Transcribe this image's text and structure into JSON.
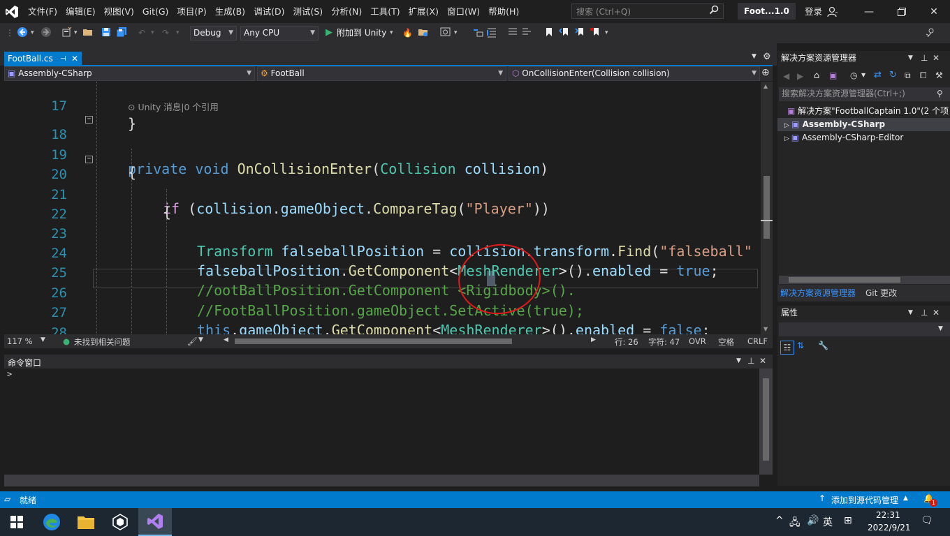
{
  "menu": {
    "items": [
      "文件(F)",
      "编辑(E)",
      "视图(V)",
      "Git(G)",
      "项目(P)",
      "生成(B)",
      "调试(D)",
      "测试(S)",
      "分析(N)",
      "工具(T)",
      "扩展(X)",
      "窗口(W)",
      "帮助(H)"
    ],
    "search_placeholder": "搜索 (Ctrl+Q)",
    "solution_title": "Foot...1.0",
    "login_label": "登录"
  },
  "toolbar": {
    "config": "Debug",
    "platform": "Any CPU",
    "attach_label": "附加到 Unity"
  },
  "editor": {
    "tab_label": "FootBall.cs",
    "nav_project": "Assembly-CSharp",
    "nav_class": "FootBall",
    "nav_member": "OnCollisionEnter(Collision collision)",
    "codelens": "Unity 消息|0 个引用",
    "line_numbers": [
      "17",
      "18",
      "19",
      "20",
      "21",
      "22",
      "23",
      "24",
      "25",
      "26",
      "27",
      "28"
    ],
    "code": {
      "l17": "}",
      "l18_kw1": "private",
      "l18_kw2": "void",
      "l18_fn": "OnCollisionEnter",
      "l18_p1": "(",
      "l18_ty": "Collision",
      "l18_va": "collision",
      "l18_p2": ")",
      "l19": "{",
      "l20_kw": "if",
      "l20_p1": " (",
      "l20_va": "collision",
      "l20_p2": ".",
      "l20_va2": "gameObject",
      "l20_p3": ".",
      "l20_fn": "CompareTag",
      "l20_p4": "(",
      "l20_st": "\"Player\"",
      "l20_p5": "))",
      "l21": "{",
      "l23_ty": "Transform",
      "l23_va": "falseballPosition",
      "l23_p1": " = ",
      "l23_va2": "collision",
      "l23_p2": ".",
      "l23_va3": "transform",
      "l23_p3": ".",
      "l23_fn": "Find",
      "l23_p4": "(",
      "l23_st": "\"falseball\"",
      "l24_va": "falseballPosition",
      "l24_p1": ".",
      "l24_fn": "GetComponent",
      "l24_p2": "<",
      "l24_ty": "MeshRenderer",
      "l24_p3": ">().",
      "l24_va2": "enabled",
      "l24_p4": " = ",
      "l24_kw": "true",
      "l24_p5": ";",
      "l25": "//ootBallPosition.GetComponent <Rigidbody>().",
      "l26": "//FootBallPosition.gameObject.SetActive(true);",
      "l27_kw": "this",
      "l27_p1": ".",
      "l27_va": "gameObject",
      "l27_p2": ".",
      "l27_fn": "GetComponent",
      "l27_p3": "<",
      "l27_ty": "MeshRenderer",
      "l27_p4": ">().",
      "l27_va2": "enabled",
      "l27_p5": " = ",
      "l27_kw2": "false",
      "l27_p6": ";"
    },
    "zoom": "117 %",
    "issues": "未找到相关问题",
    "row": "行: 26",
    "col": "字符: 47",
    "ovr": "OVR",
    "spaces": "空格",
    "eol": "CRLF"
  },
  "command_window": {
    "title": "命令窗口",
    "prompt": ">"
  },
  "solution_explorer": {
    "title": "解决方案资源管理器",
    "search_placeholder": "搜索解决方案资源管理器(Ctrl+;)",
    "solution": "解决方案\"FootballCaptain 1.0\"(2 个项目",
    "projects": [
      "Assembly-CSharp",
      "Assembly-CSharp-Editor"
    ],
    "tab_active": "解决方案资源管理器",
    "tab_other": "Git 更改"
  },
  "properties": {
    "title": "属性"
  },
  "statusbar": {
    "ready": "就绪",
    "source_control": "添加到源代码管理",
    "notifications": "1"
  },
  "taskbar": {
    "time": "22:31",
    "date": "2022/9/21",
    "ime": "英"
  },
  "colors": {
    "accent": "#007acc",
    "annotation_circle": "#e01a1a"
  }
}
